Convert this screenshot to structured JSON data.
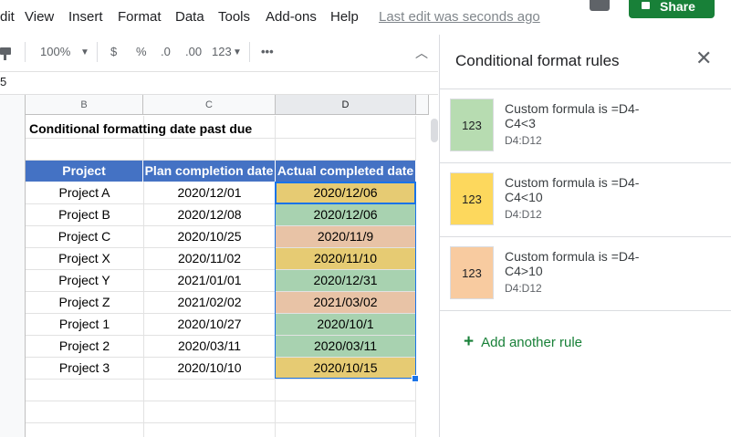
{
  "menu": {
    "items": [
      "dit",
      "View",
      "Insert",
      "Format",
      "Data",
      "Tools",
      "Add-ons",
      "Help"
    ],
    "last_edit": "Last edit was seconds ago",
    "share_label": "Share"
  },
  "toolbar": {
    "zoom": "100%",
    "currency": "$",
    "percent": "%",
    "dec_less": ".0",
    "dec_more": ".00",
    "number_format": "123"
  },
  "formula_bar": {
    "value": "5"
  },
  "columns": [
    "B",
    "C",
    "D"
  ],
  "sheet": {
    "title": "Conditional formatting date past due",
    "headers": [
      "Project",
      "Plan completion date",
      "Actual completed date"
    ],
    "rows": [
      {
        "project": "Project A",
        "plan": "2020/12/01",
        "actual": "2020/12/06",
        "color": "#e6cb73"
      },
      {
        "project": "Project B",
        "plan": "2020/12/08",
        "actual": "2020/12/06",
        "color": "#a8d2b0"
      },
      {
        "project": "Project C",
        "plan": "2020/10/25",
        "actual": "2020/11/9",
        "color": "#e8c3a6"
      },
      {
        "project": "Project X",
        "plan": "2020/11/02",
        "actual": "2020/11/10",
        "color": "#e6cb73"
      },
      {
        "project": "Project Y",
        "plan": "2021/01/01",
        "actual": "2020/12/31",
        "color": "#a8d2b0"
      },
      {
        "project": "Project Z",
        "plan": "2021/02/02",
        "actual": "2021/03/02",
        "color": "#e8c3a6"
      },
      {
        "project": "Project 1",
        "plan": "2020/10/27",
        "actual": "2020/10/1",
        "color": "#a8d2b0"
      },
      {
        "project": "Project 2",
        "plan": "2020/03/11",
        "actual": "2020/03/11",
        "color": "#a8d2b0"
      },
      {
        "project": "Project 3",
        "plan": "2020/10/10",
        "actual": "2020/10/15",
        "color": "#e6cb73"
      }
    ]
  },
  "panel": {
    "title": "Conditional format rules",
    "close_icon": "close-icon",
    "rules": [
      {
        "preview": "123",
        "color": "#b7dcb1",
        "line1": "Custom formula is =D4-",
        "line2": "C4<3",
        "range": "D4:D12"
      },
      {
        "preview": "123",
        "color": "#fdd85d",
        "line1": "Custom formula is =D4-",
        "line2": "C4<10",
        "range": "D4:D12"
      },
      {
        "preview": "123",
        "color": "#f8cba0",
        "line1": "Custom formula is =D4-",
        "line2": "C4>10",
        "range": "D4:D12"
      }
    ],
    "add_rule": "Add another rule"
  }
}
